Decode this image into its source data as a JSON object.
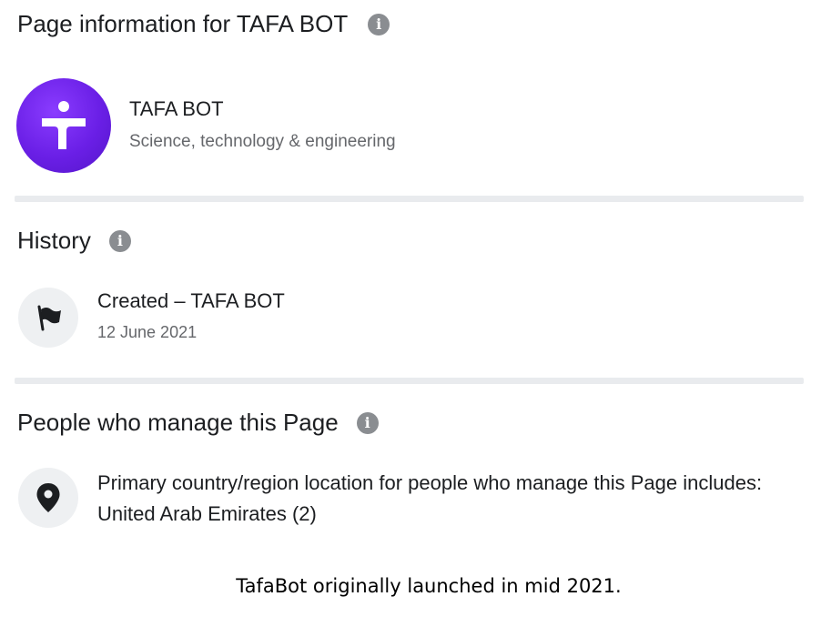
{
  "header": {
    "title": "Page information for TAFA BOT",
    "info_icon": "info-icon"
  },
  "page": {
    "name": "TAFA BOT",
    "category": "Science, technology & engineering",
    "avatar_icon": "tafa-logo",
    "avatar_color": "#6a1fe6"
  },
  "history": {
    "title": "History",
    "info_icon": "info-icon",
    "event_icon": "flag-icon",
    "event_title": "Created – TAFA BOT",
    "event_date": "12 June 2021"
  },
  "managers": {
    "title": "People who manage this Page",
    "info_icon": "info-icon",
    "location_icon": "location-pin-icon",
    "location_line1": "Primary country/region location for people who manage this Page includes:",
    "location_line2": "United Arab Emirates (2)"
  },
  "caption": "TafaBot originally launched in mid 2021."
}
